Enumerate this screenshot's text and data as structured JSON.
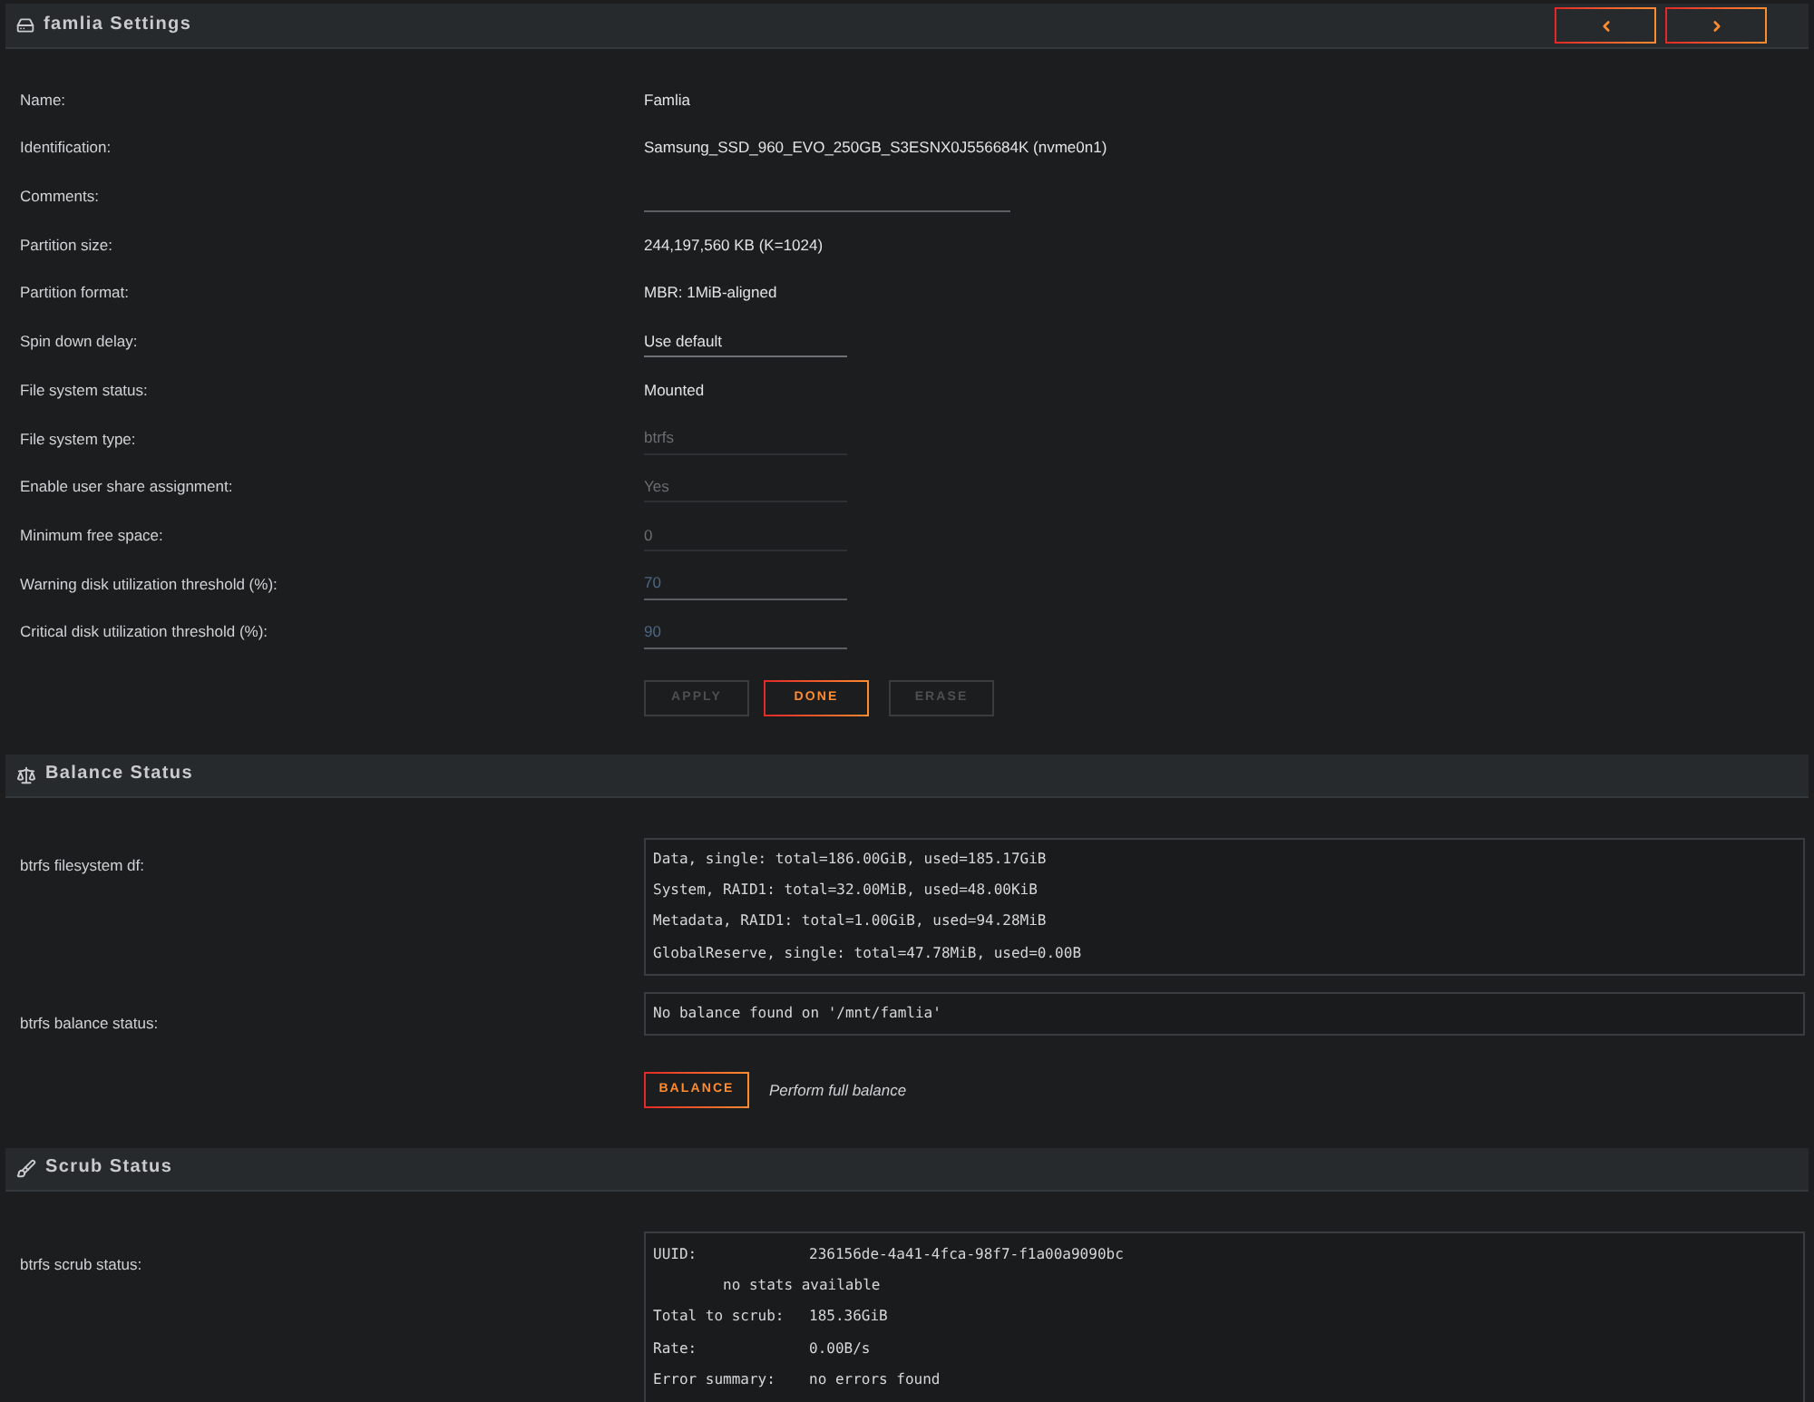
{
  "settings": {
    "title": "famlia Settings",
    "rows": [
      {
        "label": "Name:",
        "kind": "text",
        "value": "Famlia",
        "disabled": false
      },
      {
        "label": "Identification:",
        "kind": "text",
        "value": "Samsung_SSD_960_EVO_250GB_S3ESNX0J556684K (nvme0n1)",
        "disabled": false
      },
      {
        "label": "Comments:",
        "kind": "textfield",
        "disabled": false
      },
      {
        "label": "Partition size:",
        "kind": "text",
        "value": "244,197,560 KB (K=1024)",
        "disabled": false
      },
      {
        "label": "Partition format:",
        "kind": "text",
        "value": "MBR: 1MiB-aligned",
        "disabled": false
      },
      {
        "label": "Spin down delay:",
        "kind": "select",
        "value": "Use default",
        "disabled": false
      },
      {
        "label": "File system status:",
        "kind": "text",
        "value": "Mounted",
        "disabled": false
      },
      {
        "label": "File system type:",
        "kind": "select",
        "value": "btrfs",
        "disabled": true
      },
      {
        "label": "Enable user share assignment:",
        "kind": "select",
        "value": "Yes",
        "disabled": true
      },
      {
        "label": "Minimum free space:",
        "kind": "numberfield",
        "value": "0",
        "disabled": true
      },
      {
        "label": "Warning disk utilization threshold (%):",
        "kind": "numberfield",
        "placeholder": "70",
        "disabled": false
      },
      {
        "label": "Critical disk utilization threshold (%):",
        "kind": "numberfield",
        "placeholder": "90",
        "disabled": false
      }
    ],
    "buttons": [
      {
        "label": "APPLY",
        "disabled": true
      },
      {
        "label": "DONE",
        "disabled": false
      },
      {
        "label": "ERASE",
        "disabled": true
      }
    ]
  },
  "balance": {
    "title": "Balance Status",
    "df": {
      "label": "btrfs filesystem df:",
      "lines": [
        "Data, single: total=186.00GiB, used=185.17GiB",
        "System, RAID1: total=32.00MiB, used=48.00KiB",
        "Metadata, RAID1: total=1.00GiB, used=94.28MiB",
        "GlobalReserve, single: total=47.78MiB, used=0.00B"
      ]
    },
    "status": {
      "label": "btrfs balance status:",
      "text": "No balance found on '/mnt/famlia'"
    },
    "action": {
      "button": "BALANCE",
      "disabled": false,
      "hint": "Perform full balance"
    }
  },
  "scrub": {
    "title": "Scrub Status",
    "label": "btrfs scrub status:",
    "lines": [
      {
        "kind": "pair",
        "label": "UUID:",
        "value": "236156de-4a41-4fca-98f7-f1a00a9090bc"
      },
      {
        "kind": "note",
        "text": "no stats available"
      },
      {
        "kind": "pair",
        "label": "Total to scrub:",
        "value": "185.36GiB"
      },
      {
        "kind": "pair",
        "label": "Rate:",
        "value": "0.00B/s"
      },
      {
        "kind": "pair",
        "label": "Error summary:",
        "value": "no errors found"
      }
    ]
  }
}
